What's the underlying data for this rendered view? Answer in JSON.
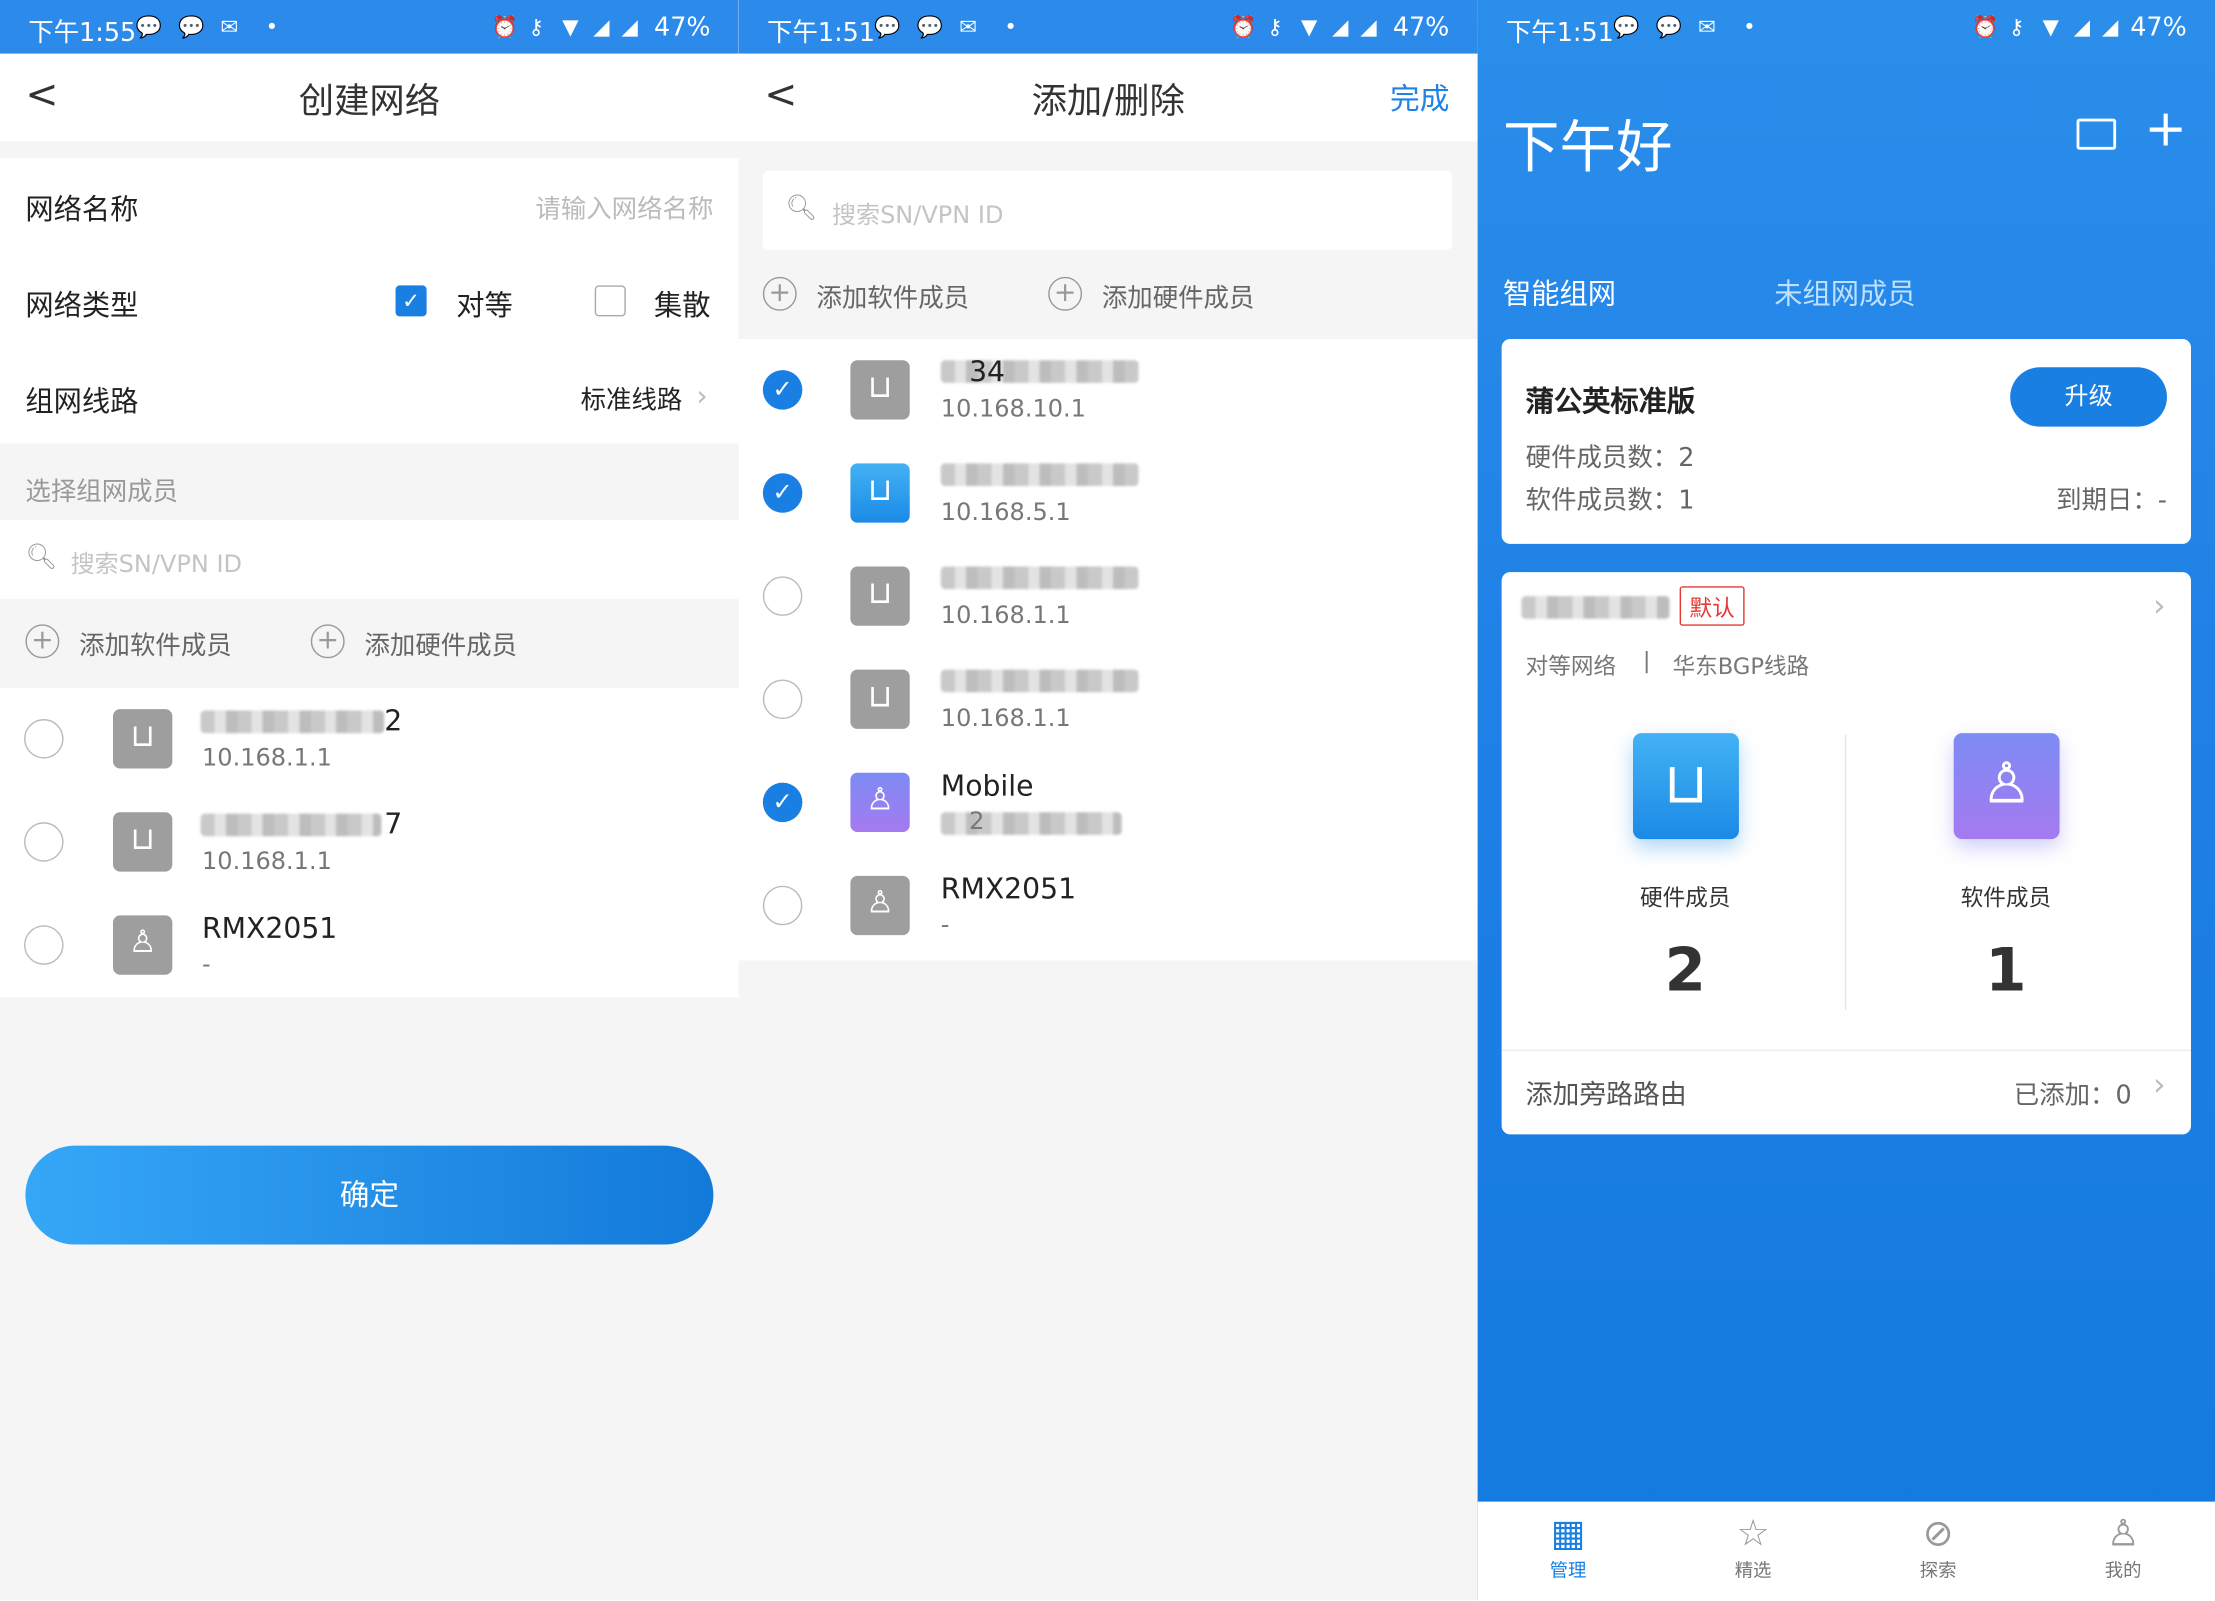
{
  "screen1": {
    "status": {
      "time": "下午1:55",
      "battery": "47%"
    },
    "nav": {
      "title": "创建网络"
    },
    "network_name": {
      "label": "网络名称",
      "placeholder": "请输入网络名称"
    },
    "network_type": {
      "label": "网络类型",
      "option1": "对等",
      "option2": "集散",
      "option1_checked": true,
      "option2_checked": false
    },
    "route": {
      "label": "组网线路",
      "value": "标准线路"
    },
    "section_label": "选择组网成员",
    "search_placeholder": "搜索SN/VPN ID",
    "add_software": "添加软件成员",
    "add_hardware": "添加硬件成员",
    "members": [
      {
        "name_visible": "2",
        "ip": "10.168.1.1",
        "icon": "router-icon",
        "checked": false
      },
      {
        "name_visible": "7",
        "ip": "10.168.1.1",
        "icon": "router-icon",
        "checked": false
      },
      {
        "name_visible": "RMX2051",
        "ip": "-",
        "icon": "user-icon",
        "checked": false
      }
    ],
    "confirm": "确定"
  },
  "screen2": {
    "status": {
      "time": "下午1:51",
      "battery": "47%"
    },
    "nav": {
      "title": "添加/删除",
      "done": "完成"
    },
    "search_placeholder": "搜索SN/VPN ID",
    "add_software": "添加软件成员",
    "add_hardware": "添加硬件成员",
    "members": [
      {
        "name_visible": "34",
        "ip": "10.168.10.1",
        "icon": "router-icon",
        "checked": true
      },
      {
        "name_visible": "",
        "ip": "10.168.5.1",
        "icon": "router-icon",
        "checked": true
      },
      {
        "name_visible": "",
        "ip": "10.168.1.1",
        "icon": "router-icon",
        "checked": false
      },
      {
        "name_visible": "",
        "ip": "10.168.1.1",
        "icon": "router-icon",
        "checked": false
      },
      {
        "name_visible": "Mobile",
        "ip": "2",
        "icon": "user-icon",
        "checked": true
      },
      {
        "name_visible": "RMX2051",
        "ip": "-",
        "icon": "user-icon",
        "checked": false
      }
    ]
  },
  "screen3": {
    "status": {
      "time": "下午1:51",
      "battery": "47%"
    },
    "greeting": "下午好",
    "tabs": [
      "智能组网",
      "未组网成员"
    ],
    "plan": {
      "title": "蒲公英标准版",
      "upgrade": "升级",
      "hardware_count": "硬件成员数：2",
      "software_count": "软件成员数：1",
      "expiry": "到期日：-"
    },
    "network": {
      "default_badge": "默认",
      "type": "对等网络",
      "separator": "|",
      "route": "华东BGP线路",
      "hardware_label": "硬件成员",
      "hardware_count": "2",
      "software_label": "软件成员",
      "software_count": "1",
      "bypass_label": "添加旁路路由",
      "bypass_added": "已添加：0"
    },
    "tabbar": [
      "管理",
      "精选",
      "探索",
      "我的"
    ]
  },
  "colors": {
    "accent": "#1a7fe2",
    "status_bar": "#2b8aea",
    "badge_red": "#e53935"
  }
}
